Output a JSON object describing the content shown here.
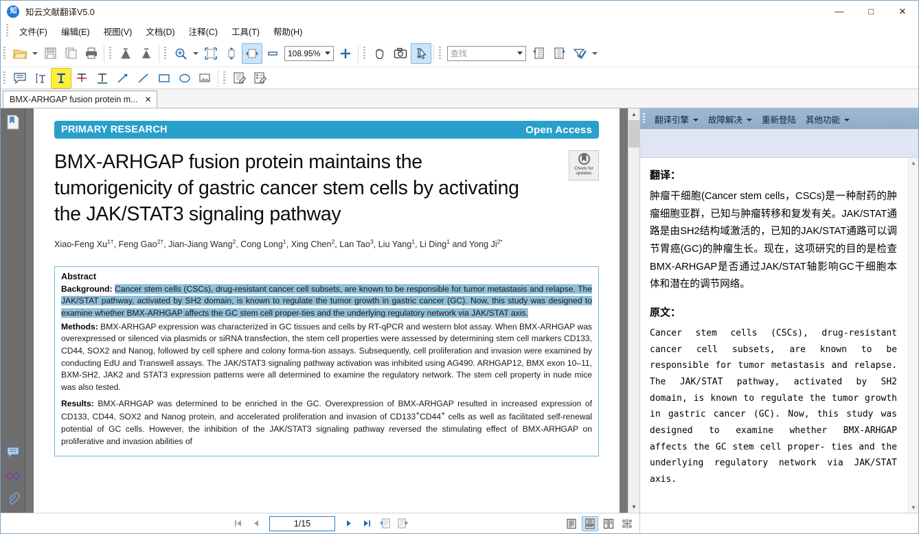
{
  "window": {
    "title": "知云文献翻译V5.0",
    "logo_text": "知",
    "minimize": "—",
    "maximize": "□",
    "close": "✕"
  },
  "menu": {
    "items": [
      {
        "label": "文件(F)",
        "name": "menu-file"
      },
      {
        "label": "编辑(E)",
        "name": "menu-edit"
      },
      {
        "label": "视图(V)",
        "name": "menu-view"
      },
      {
        "label": "文档(D)",
        "name": "menu-document"
      },
      {
        "label": "注释(C)",
        "name": "menu-annotation"
      },
      {
        "label": "工具(T)",
        "name": "menu-tools"
      },
      {
        "label": "帮助(H)",
        "name": "menu-help"
      }
    ]
  },
  "toolbar": {
    "zoom_value": "108.95%",
    "find_placeholder": "查找",
    "buttons": [
      "open-icon",
      "save-icon",
      "copy-icon",
      "print-icon",
      "rotate-left-icon",
      "rotate-right-icon",
      "zoom-in-icon",
      "fit-page-icon",
      "fit-height-icon",
      "fit-width-icon",
      "zoom-out-icon",
      "zoom-plus-icon",
      "hand-tool-icon",
      "snapshot-icon",
      "text-select-icon",
      "prev-view-icon",
      "next-view-icon",
      "filter-icon"
    ],
    "annotation_buttons": [
      "sticky-note-icon",
      "text-select-icon",
      "highlight-icon",
      "strikethrough-icon",
      "underline-icon",
      "arrow-icon",
      "line-icon",
      "rectangle-icon",
      "ellipse-icon",
      "stamp-icon",
      "edit-text-icon",
      "edit-object-icon"
    ]
  },
  "tab": {
    "label": "BMX-ARHGAP fusion protein m...",
    "close": "✕"
  },
  "document": {
    "banner_left": "PRIMARY RESEARCH",
    "banner_right": "Open Access",
    "title": "BMX-ARHGAP fusion protein maintains the tumorigenicity of gastric cancer stem cells by activating the JAK/STAT3 signaling pathway",
    "updates_badge_line1": "Check for",
    "updates_badge_line2": "updates",
    "authors_html": "Xiao-Feng Xu<sup>1†</sup>, Feng Gao<sup>2†</sup>, Jian-Jiang Wang<sup>2</sup>, Cong Long<sup>1</sup>, Xing Chen<sup>2</sup>, Lan Tao<sup>3</sup>, Liu Yang<sup>1</sup>, Li Ding<sup>1</sup> and Yong Ji<sup>2*</sup>",
    "abstract_heading": "Abstract",
    "background_label": "Background:",
    "background_text": "Cancer stem cells (CSCs), drug-resistant cancer cell subsets, are known to be responsible for tumor metastasis and relapse. The JAK/STAT pathway, activated by SH2 domain, is known to regulate the tumor growth in gastric cancer (GC). Now, this study was designed to examine whether BMX-ARHGAP affects the GC stem cell proper-ties and the underlying regulatory network via JAK/STAT axis.",
    "methods_label": "Methods:",
    "methods_text": "BMX-ARHGAP expression was characterized in GC tissues and cells by RT-qPCR and western blot assay. When BMX-ARHGAP was overexpressed or silenced via plasmids or siRNA transfection, the stem cell properties were assessed by determining stem cell markers CD133, CD44, SOX2 and Nanog, followed by cell sphere and colony forma-tion assays. Subsequently, cell proliferation and invasion were examined by conducting EdU and Transwell assays. The JAK/STAT3 signaling pathway activation was inhibited using AG490. ARHGAP12, BMX exon 10–11, BXM-SH2, JAK2 and STAT3 expression patterns were all determined to examine the regulatory network. The stem cell property in nude mice was also tested.",
    "results_label": "Results:",
    "results_text_1": "BMX-ARHGAP was determined to be enriched in the GC. Overexpression of BMX-ARHGAP resulted in increased expression of CD133, CD44, SOX2 and Nanog protein, and accelerated proliferation and invasion of CD133",
    "results_sup_1": "+",
    "results_text_2": "CD44",
    "results_sup_2": "+",
    "results_text_3": " cells as well as facilitated self-renewal potential of GC cells. However, the inhibition of the JAK/STAT3 signaling pathway reversed the stimulating effect of BMX-ARHGAP on proliferative and invasion abilities of"
  },
  "right_panel": {
    "toolbar_items": [
      {
        "label": "翻译引擎",
        "has_caret": true,
        "name": "translate-engine-menu"
      },
      {
        "label": "故障解决",
        "has_caret": true,
        "name": "troubleshoot-menu"
      },
      {
        "label": "重新登陆",
        "has_caret": false,
        "name": "relogin-button"
      },
      {
        "label": "其他功能",
        "has_caret": true,
        "name": "other-functions-menu"
      }
    ],
    "translation_heading": "翻译：",
    "translation_text": "肿瘤干细胞(Cancer stem cells，CSCs)是一种耐药的肿瘤细胞亚群，已知与肿瘤转移和复发有关。JAK/STAT通路是由SH2结构域激活的，已知的JAK/STAT通路可以调节胃癌(GC)的肿瘤生长。现在，这项研究的目的是检查BMX-ARHGAP是否通过JAK/STAT轴影响GC干细胞本体和潜在的调节网络。",
    "source_heading": "原文：",
    "source_text": "Cancer stem cells (CSCs), drug-resistant cancer cell subsets, are known to be responsible for tumor metastasis and relapse. The JAK/STAT pathway, activated by SH2 domain, is known to regulate the tumor growth in gastric cancer (GC). Now, this study was designed to examine whether BMX-ARHGAP affects the GC stem cell proper- ties and the underlying regulatory network via JAK/STAT axis."
  },
  "statusbar": {
    "page_indicator": "1/15",
    "first_page": "|◀",
    "prev_page": "◀",
    "next_page": "▶",
    "last_page": "▶|",
    "view_modes": [
      "single-page-icon",
      "continuous-page-icon",
      "two-page-icon",
      "two-page-continuous-icon"
    ],
    "active_view_mode": 1
  },
  "colors": {
    "banner": "#29a0cb",
    "selection": "#8fc0dc",
    "accent": "#2a7fc9",
    "panel_toolbar": "#95aecd"
  }
}
